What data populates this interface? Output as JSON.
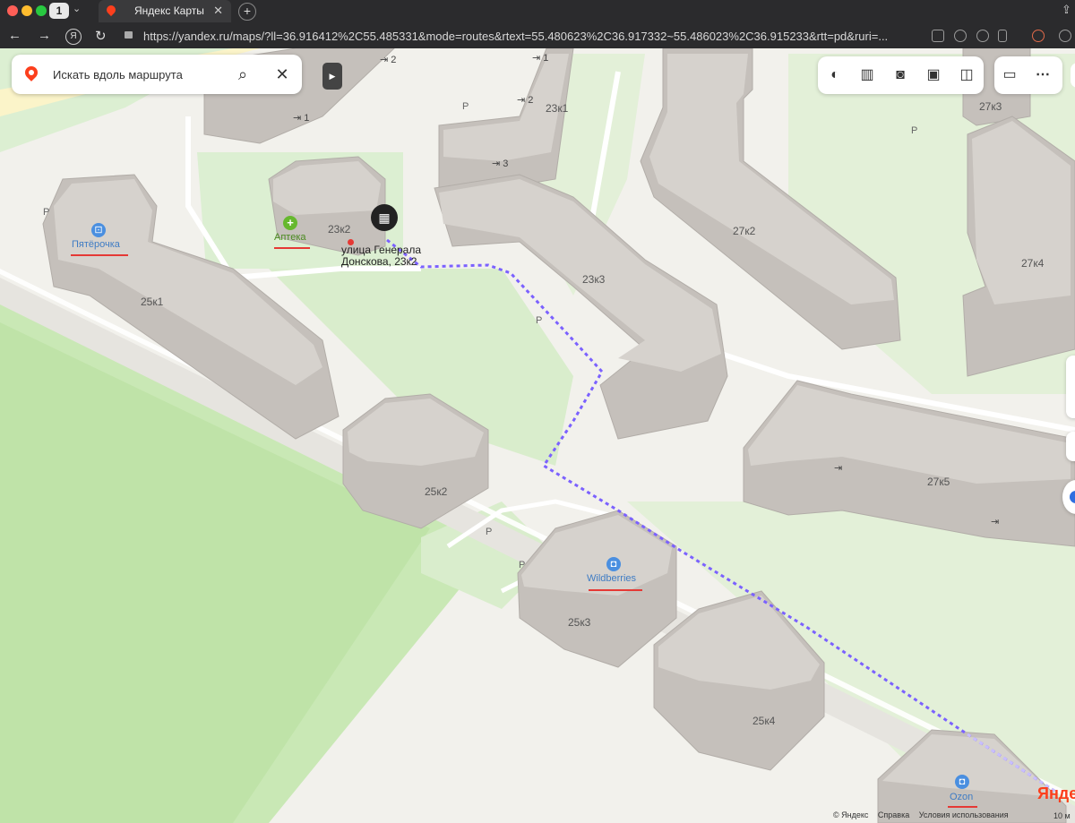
{
  "browser": {
    "tab_count": "1",
    "tab_title": "Яндекс Карты",
    "url": "https://yandex.ru/maps/?ll=36.916412%2C55.485331&mode=routes&rtext=55.480623%2C36.917332~55.486023%2C36.915233&rtt=pd&ruri=..."
  },
  "search": {
    "placeholder": "Искать вдоль маршрута"
  },
  "map": {
    "building_labels": [
      "23к1",
      "23к2",
      "23к3",
      "25к1",
      "25к2",
      "25к3",
      "25к4",
      "27к2",
      "27к3",
      "27к4",
      "27к5"
    ],
    "parking_label": "P",
    "entrances": [
      "2",
      "1",
      "1",
      "2",
      "3"
    ],
    "address": {
      "line1": "улица Генерала",
      "line2": "Донскова, 23к2"
    },
    "pois": [
      {
        "name": "Пятёрочка",
        "icon": "basket-icon",
        "color": "#4a8fe0"
      },
      {
        "name": "Аптека",
        "icon": "pharmacy-cross-icon",
        "color": "#66b82e"
      },
      {
        "name": "Wildberries",
        "icon": "shopping-bag-icon",
        "color": "#4a8fe0"
      },
      {
        "name": "Ozon",
        "icon": "shopping-bag-icon",
        "color": "#4a8fe0"
      }
    ],
    "route_color": "#7b61ff"
  },
  "footer": {
    "copyright": "© Яндекс",
    "help": "Справка",
    "terms": "Условия использования",
    "scale": "10 м",
    "logo_a": "Янде",
    "logo_b": "к"
  }
}
